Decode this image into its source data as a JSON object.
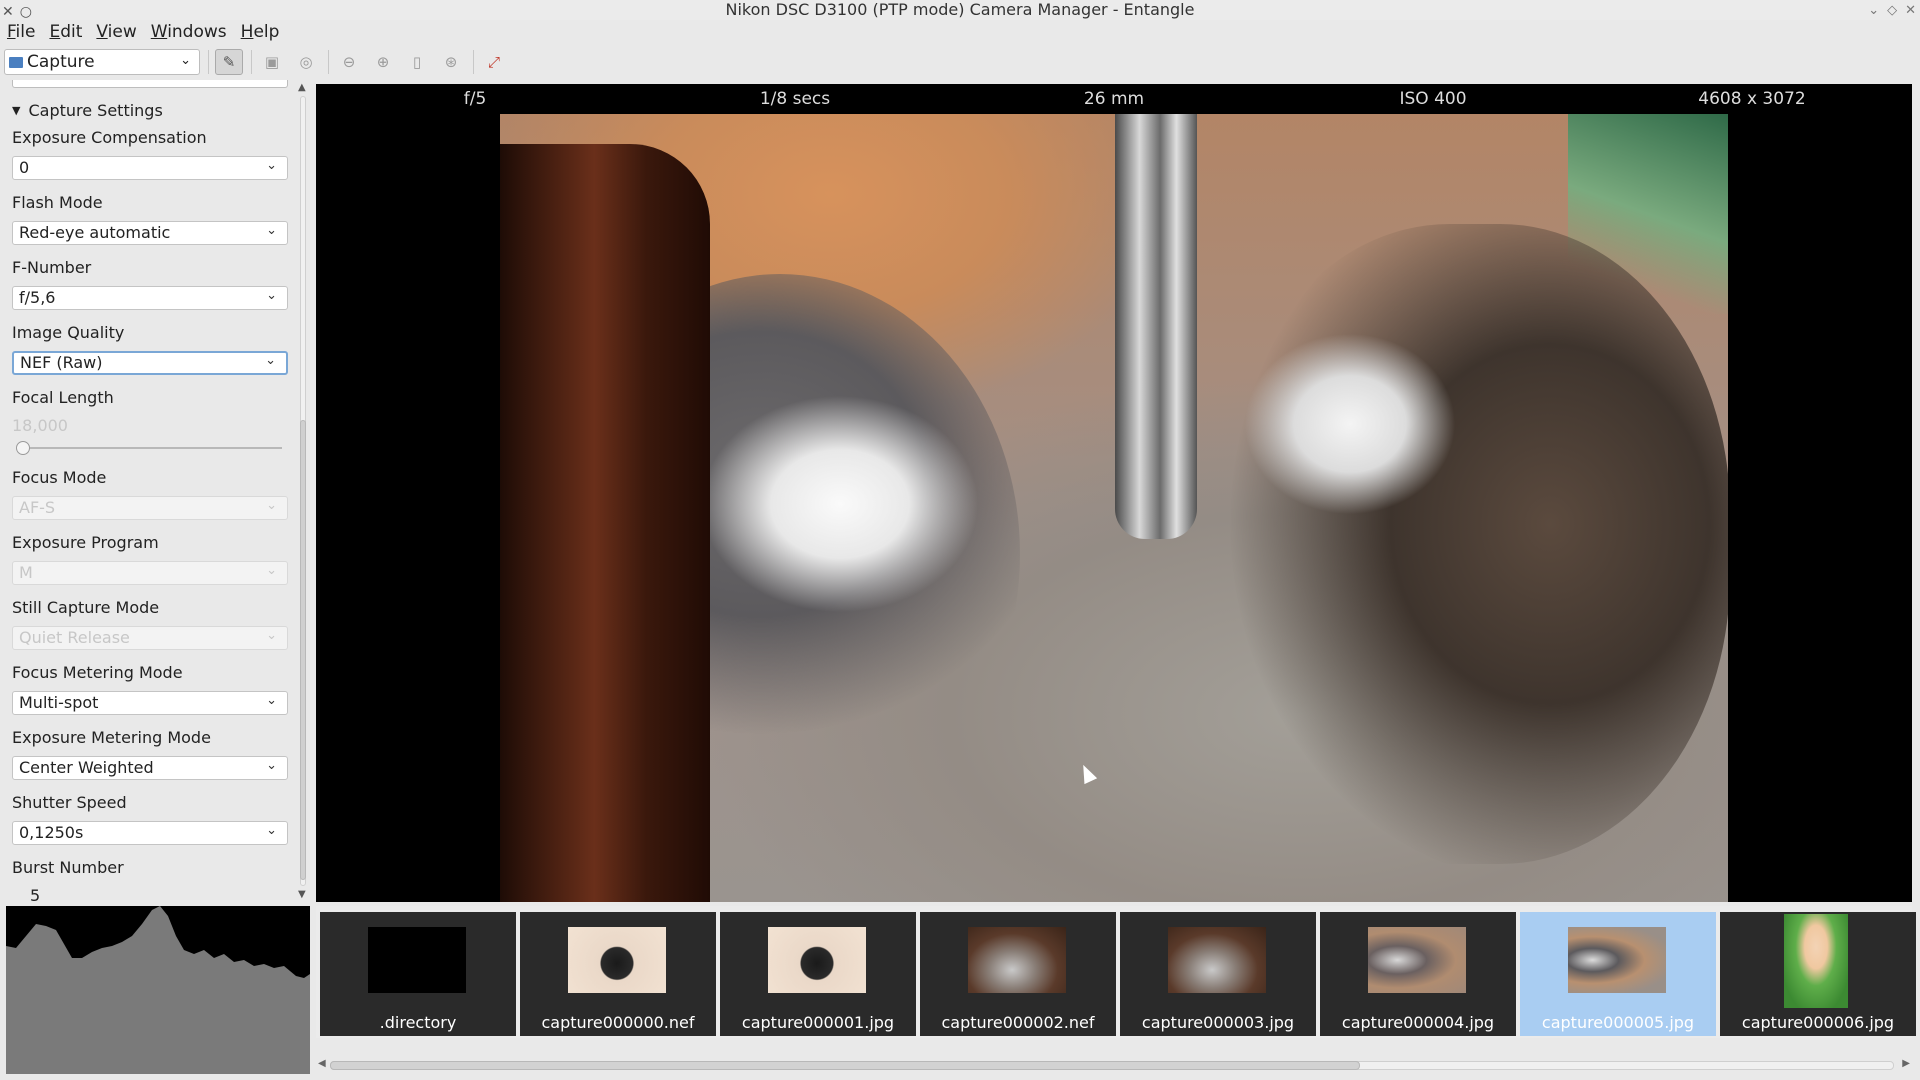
{
  "window": {
    "title": "Nikon DSC D3100 (PTP mode) Camera Manager - Entangle"
  },
  "menu": [
    "File",
    "Edit",
    "View",
    "Windows",
    "Help"
  ],
  "toolbar": {
    "mode": "Capture"
  },
  "panel": {
    "section": "Capture Settings",
    "fields": [
      {
        "label": "Exposure Compensation",
        "type": "select",
        "value": "0",
        "enabled": true
      },
      {
        "label": "Flash Mode",
        "type": "select",
        "value": "Red-eye automatic",
        "enabled": true
      },
      {
        "label": "F-Number",
        "type": "select",
        "value": "f/5,6",
        "enabled": true
      },
      {
        "label": "Image Quality",
        "type": "select",
        "value": "NEF (Raw)",
        "enabled": true,
        "focused": true
      },
      {
        "label": "Focal Length",
        "type": "slider",
        "value": "18,000",
        "enabled": false,
        "level": 0
      },
      {
        "label": "Focus Mode",
        "type": "select",
        "value": "AF-S",
        "enabled": false
      },
      {
        "label": "Exposure Program",
        "type": "select",
        "value": "M",
        "enabled": false
      },
      {
        "label": "Still Capture Mode",
        "type": "select",
        "value": "Quiet Release",
        "enabled": false
      },
      {
        "label": "Focus Metering Mode",
        "type": "select",
        "value": "Multi-spot",
        "enabled": true
      },
      {
        "label": "Exposure Metering Mode",
        "type": "select",
        "value": "Center Weighted",
        "enabled": true
      },
      {
        "label": "Shutter Speed",
        "type": "select",
        "value": "0,1250s",
        "enabled": true
      },
      {
        "label": "Burst Number",
        "type": "slider",
        "value": "5",
        "enabled": true,
        "level": 0.04
      }
    ]
  },
  "info": [
    "f/5",
    "1/8 secs",
    "26 mm",
    "ISO 400",
    "4608 x 3072"
  ],
  "thumbnails": [
    {
      "name": ".directory",
      "kind": "empty"
    },
    {
      "name": "capture000000.nef",
      "kind": "cap"
    },
    {
      "name": "capture000001.jpg",
      "kind": "cap"
    },
    {
      "name": "capture000002.nef",
      "kind": "cat"
    },
    {
      "name": "capture000003.jpg",
      "kind": "cat"
    },
    {
      "name": "capture000004.jpg",
      "kind": "cat"
    },
    {
      "name": "capture000005.jpg",
      "kind": "cat",
      "selected": true
    },
    {
      "name": "capture000006.jpg",
      "kind": "girl"
    }
  ]
}
